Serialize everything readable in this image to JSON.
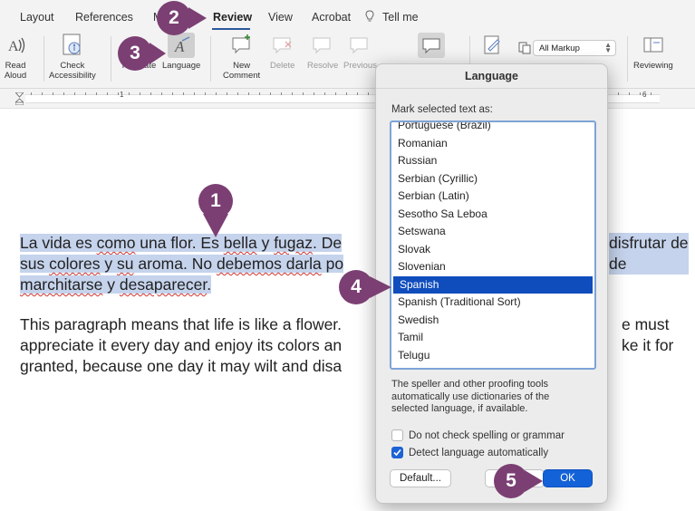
{
  "tabs": [
    "Layout",
    "References",
    "M",
    "Review",
    "View",
    "Acrobat",
    "Tell me"
  ],
  "active_tab": "Review",
  "ribbon": {
    "read_aloud": [
      "Read",
      "Aloud"
    ],
    "check_accessibility": [
      "Check",
      "Accessibility"
    ],
    "translate": "Translate",
    "language": "Language",
    "new_comment": [
      "New",
      "Comment"
    ],
    "delete": "Delete",
    "resolve": "Resolve",
    "previous": "Previous",
    "markup_select": "All Markup",
    "reviewing": "Reviewing"
  },
  "ruler": {
    "labels": [
      "1",
      "6"
    ]
  },
  "document": {
    "spanish_lines": [
      [
        "La vida es ",
        "como",
        " una flor. Es ",
        "bella",
        " y ",
        "fugaz",
        ". De"
      ],
      [
        "sus ",
        "colores",
        " y ",
        "su",
        " aroma. No ",
        "debemos darla",
        " po"
      ],
      [
        "marchitarse",
        " y ",
        "desaparecer",
        "."
      ]
    ],
    "spanish_right_fragments": [
      "disfrutar de",
      "de"
    ],
    "english_lines": [
      "This paragraph means that life is like a flower.",
      "appreciate it every day and enjoy its colors an",
      "granted, because one day it may wilt and disa"
    ],
    "english_right_fragments": [
      "e must",
      "ke it for"
    ]
  },
  "dialog": {
    "title": "Language",
    "prompt": "Mark selected text as:",
    "languages": [
      "Portuguese (Brazil)",
      "Romanian",
      "Russian",
      "Serbian (Cyrillic)",
      "Serbian (Latin)",
      "Sesotho Sa Leboa",
      "Setswana",
      "Slovak",
      "Slovenian",
      "Spanish",
      "Spanish (Traditional Sort)",
      "Swedish",
      "Tamil",
      "Telugu"
    ],
    "selected_language": "Spanish",
    "info_lines": [
      "The speller and other proofing tools",
      "automatically use dictionaries of the",
      "selected language, if available."
    ],
    "checkbox_no_spelling": {
      "label": "Do not check spelling or grammar",
      "checked": false
    },
    "checkbox_detect": {
      "label": "Detect language automatically",
      "checked": true
    },
    "default_button": "Default...",
    "cancel_button": "C",
    "ok_button": "OK"
  },
  "callouts": [
    "1",
    "2",
    "3",
    "4",
    "5"
  ],
  "colors": {
    "callout": "#7b3f73",
    "selection_highlight": "#c5d3ec",
    "list_selected": "#0f4dbd",
    "ok_button": "#1462d8",
    "tab_underline": "#2b579a"
  }
}
